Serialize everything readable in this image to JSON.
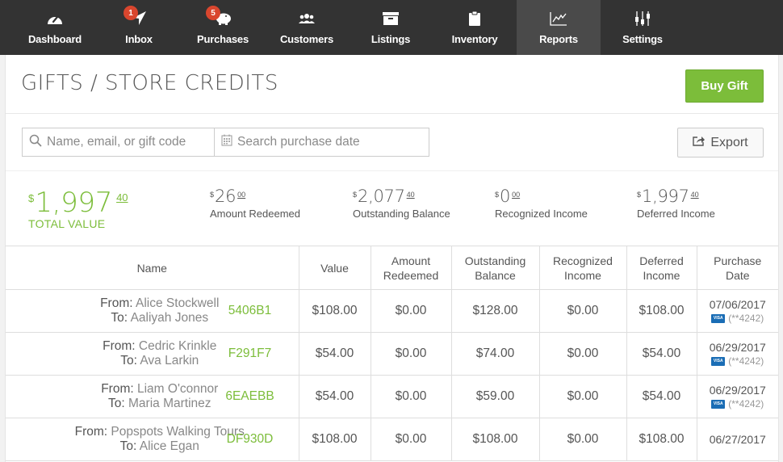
{
  "nav": {
    "items": [
      {
        "key": "dashboard",
        "label": "Dashboard",
        "icon": "speedometer-icon"
      },
      {
        "key": "inbox",
        "label": "Inbox",
        "icon": "paper-plane-icon",
        "badge": "1"
      },
      {
        "key": "purchases",
        "label": "Purchases",
        "icon": "piggy-bank-icon",
        "badge": "5"
      },
      {
        "key": "customers",
        "label": "Customers",
        "icon": "users-icon"
      },
      {
        "key": "listings",
        "label": "Listings",
        "icon": "archive-box-icon"
      },
      {
        "key": "inventory",
        "label": "Inventory",
        "icon": "clipboard-icon"
      },
      {
        "key": "reports",
        "label": "Reports",
        "icon": "line-chart-icon",
        "active": true
      },
      {
        "key": "settings",
        "label": "Settings",
        "icon": "sliders-icon"
      }
    ]
  },
  "header": {
    "title": "GIFTS / STORE CREDITS",
    "buy_gift_label": "Buy Gift"
  },
  "filters": {
    "search_placeholder": "Name, email, or gift code",
    "date_placeholder": "Search purchase date",
    "export_label": "Export"
  },
  "summary": {
    "total": {
      "currency": "$",
      "whole": "1,997",
      "cents": "40",
      "label": "TOTAL VALUE"
    },
    "stats": [
      {
        "currency": "$",
        "whole": "26",
        "cents": "00",
        "label": "Amount Redeemed"
      },
      {
        "currency": "$",
        "whole": "2,077",
        "cents": "40",
        "label": "Outstanding Balance"
      },
      {
        "currency": "$",
        "whole": "0",
        "cents": "00",
        "label": "Recognized Income"
      },
      {
        "currency": "$",
        "whole": "1,997",
        "cents": "40",
        "label": "Deferred Income"
      }
    ]
  },
  "table": {
    "headers": {
      "name": "Name",
      "value": "Value",
      "redeemed": [
        "Amount",
        "Redeemed"
      ],
      "outstanding": [
        "Outstanding",
        "Balance"
      ],
      "recognized": [
        "Recognized",
        "Income"
      ],
      "deferred": [
        "Deferred",
        "Income"
      ],
      "date": [
        "Purchase",
        "Date"
      ]
    },
    "from_prefix": "From:",
    "to_prefix": "To:",
    "rows": [
      {
        "from": "Alice Stockwell",
        "to": "Aaliyah Jones",
        "code": "5406B1",
        "value": "$108.00",
        "redeemed": "$0.00",
        "outstanding": "$128.00",
        "recognized": "$0.00",
        "deferred": "$108.00",
        "date": "07/06/2017",
        "card_brand": "VISA",
        "card": "(**4242)"
      },
      {
        "from": "Cedric Krinkle",
        "to": "Ava Larkin",
        "code": "F291F7",
        "value": "$54.00",
        "redeemed": "$0.00",
        "outstanding": "$74.00",
        "recognized": "$0.00",
        "deferred": "$54.00",
        "date": "06/29/2017",
        "card_brand": "VISA",
        "card": "(**4242)"
      },
      {
        "from": "Liam O'connor",
        "to": "Maria Martinez",
        "code": "6EAEBB",
        "value": "$54.00",
        "redeemed": "$0.00",
        "outstanding": "$59.00",
        "recognized": "$0.00",
        "deferred": "$54.00",
        "date": "06/29/2017",
        "card_brand": "VISA",
        "card": "(**4242)"
      },
      {
        "from": "Popspots Walking Tours",
        "to": "Alice Egan",
        "code": "DF930D",
        "value": "$108.00",
        "redeemed": "$0.00",
        "outstanding": "$108.00",
        "recognized": "$0.00",
        "deferred": "$108.00",
        "date": "06/27/2017"
      }
    ]
  },
  "colors": {
    "accent_green": "#7cbd3a",
    "nav_bg": "#333333",
    "nav_active": "#4a4a4a",
    "badge_red": "#d9462e",
    "visa_blue": "#1a6db5"
  }
}
